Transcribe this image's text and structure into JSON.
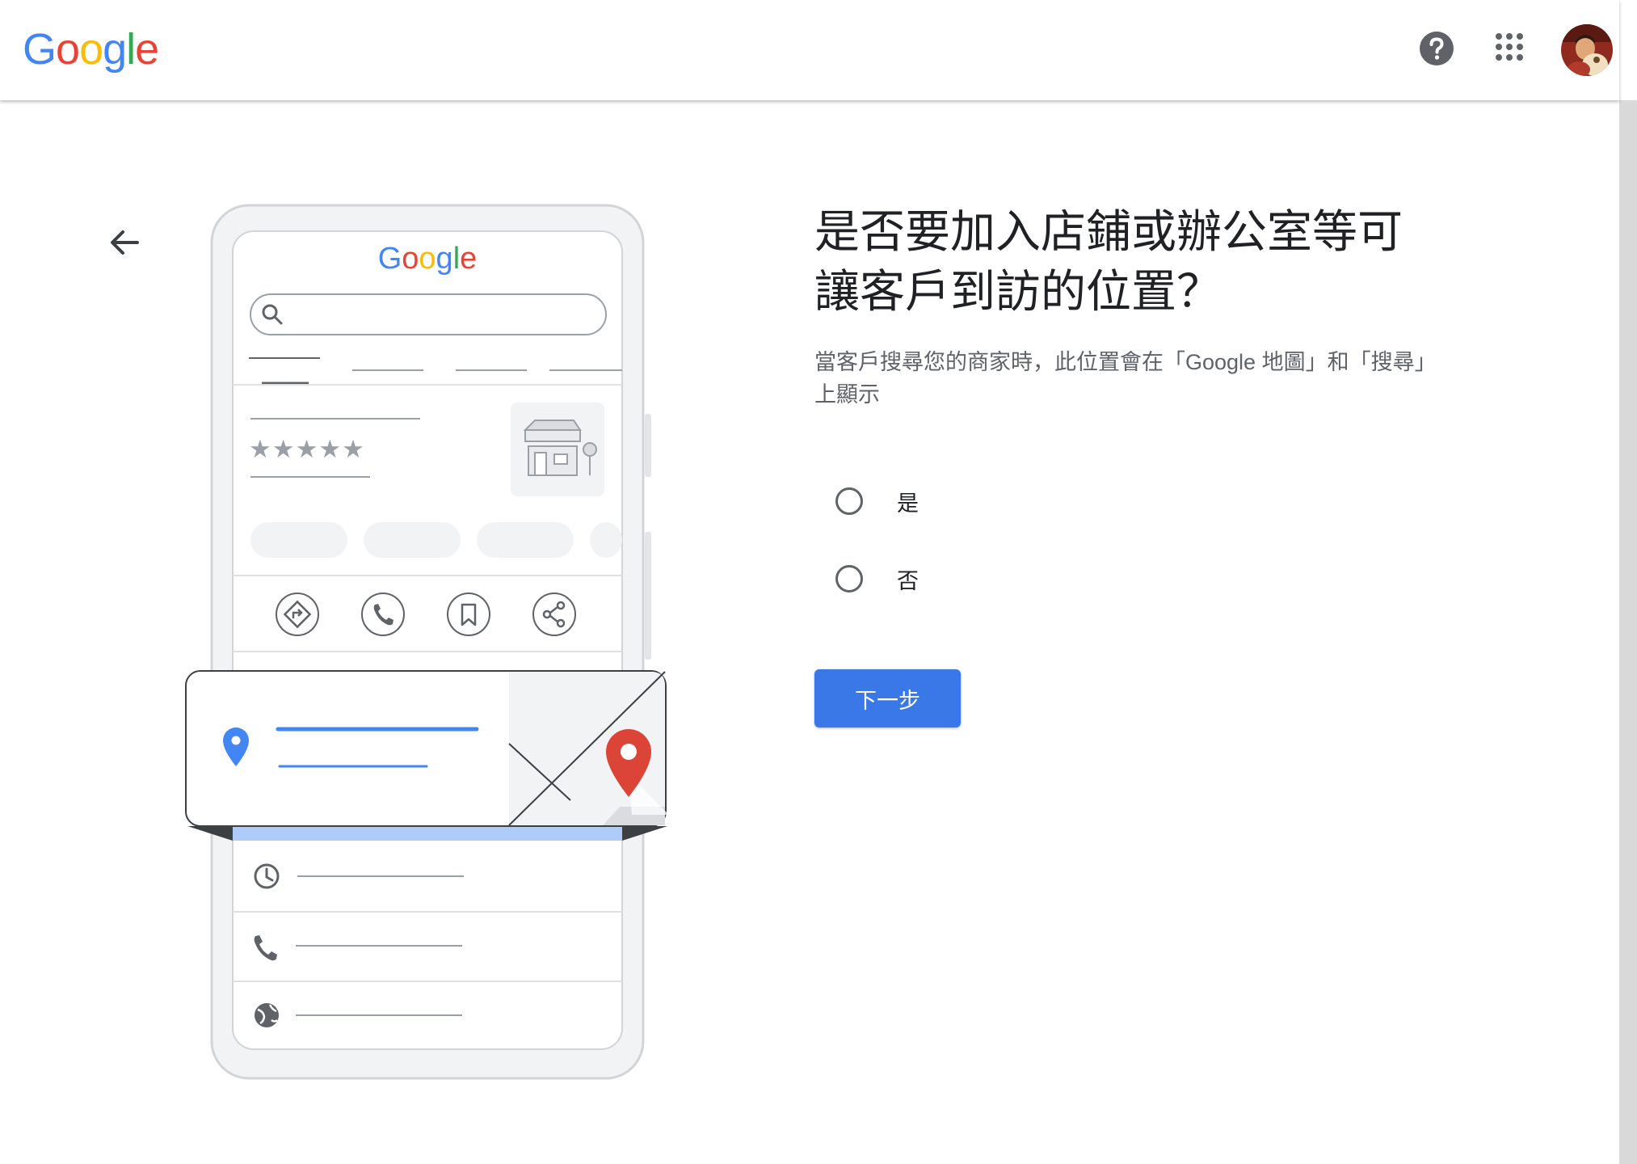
{
  "header": {
    "logo_letters": [
      "G",
      "o",
      "o",
      "g",
      "l",
      "e"
    ],
    "icons": {
      "help": "help-circle-icon",
      "apps": "apps-grid-icon",
      "avatar": "account-avatar"
    }
  },
  "illustration": {
    "phone_logo_letters": [
      "G",
      "o",
      "o",
      "g",
      "l",
      "e"
    ],
    "stars": "★★★★★",
    "icons": [
      "directions-icon",
      "phone-icon",
      "bookmark-icon",
      "share-icon",
      "location-pin-icon",
      "map-pin-icon",
      "clock-icon",
      "globe-icon"
    ]
  },
  "main": {
    "title": "是否要加入店鋪或辦公室等可讓客戶到訪的位置？",
    "subtitle": "當客戶搜尋您的商家時，此位置會在「Google 地圖」和「搜尋」上顯示",
    "options": [
      {
        "label": "是",
        "selected": false
      },
      {
        "label": "否",
        "selected": false
      }
    ],
    "next_label": "下一步"
  },
  "colors": {
    "google_blue": "#4285F4",
    "google_red": "#EA4335",
    "google_yellow": "#FBBC05",
    "google_green": "#34A853",
    "button_blue": "#3B78E7",
    "map_pin_red": "#DB4437"
  }
}
